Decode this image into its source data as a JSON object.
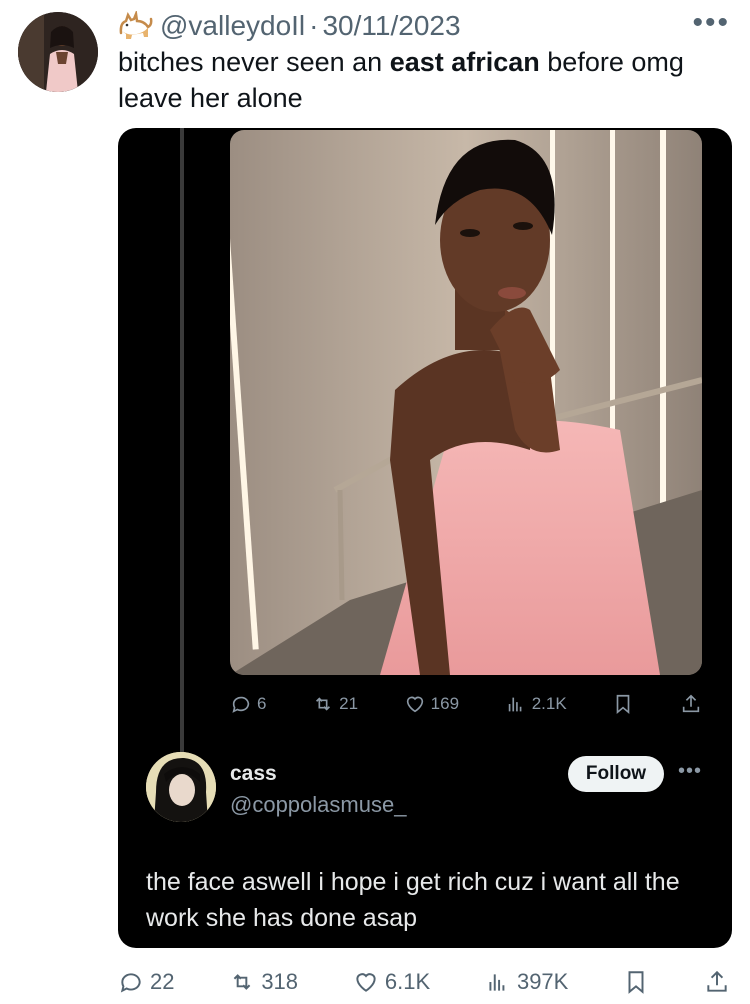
{
  "tweet": {
    "handle": "@valleydoIl",
    "separator": "·",
    "date": "30/11/2023",
    "text_before": "bitches never seen an ",
    "text_bold": "east african",
    "text_after": " before omg leave her alone",
    "more": "•••"
  },
  "quoted_post": {
    "stats": {
      "replies": "6",
      "reposts": "21",
      "likes": "169",
      "views": "2.1K"
    }
  },
  "reply": {
    "name": "cass",
    "handle": "@coppolasmuse_",
    "follow_label": "Follow",
    "more": "•••",
    "text": "the face aswell i hope i get rich cuz i want all the work she has done asap"
  },
  "actions": {
    "replies": "22",
    "reposts": "318",
    "likes": "6.1K",
    "views": "397K"
  },
  "colors": {
    "muted": "#536471",
    "embed_bg": "#000000",
    "dress": "#f2a5a8"
  }
}
